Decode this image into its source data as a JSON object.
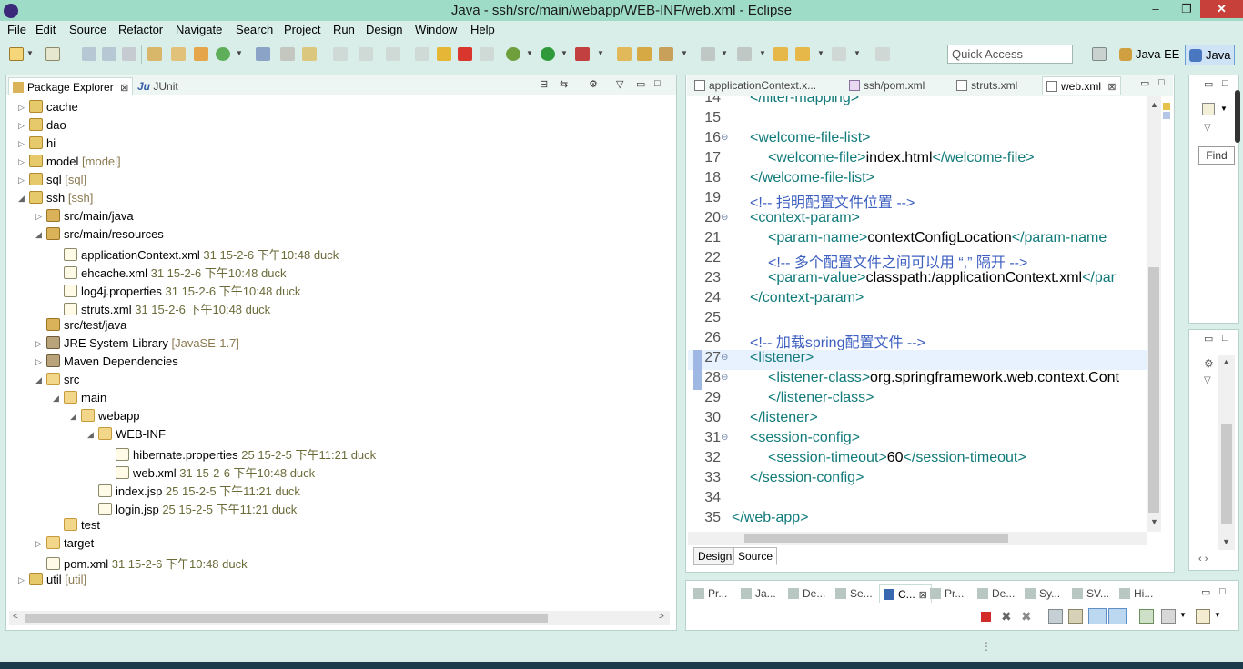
{
  "window": {
    "title": "Java - ssh/src/main/webapp/WEB-INF/web.xml - Eclipse",
    "min": "–",
    "max": "❐",
    "close": "✕"
  },
  "menu": [
    "File",
    "Edit",
    "Source",
    "Refactor",
    "Navigate",
    "Search",
    "Project",
    "Run",
    "Design",
    "Window",
    "Help"
  ],
  "toolbar": {
    "quick_access": "Quick Access",
    "perspectives": [
      "Java EE",
      "Java"
    ],
    "icons": [
      "new-icon",
      "new-dropdown-icon",
      "save-icon",
      "save-all-icon",
      "print-icon",
      "build-icon",
      "new-java-package-icon",
      "new-class-icon",
      "debug-icon",
      "run-icon",
      "run-coverage-icon",
      "external-tools-icon",
      "open-type-icon",
      "search-icon",
      "next-annotation-icon",
      "back-icon",
      "forward-icon",
      "pin-icon"
    ]
  },
  "package_explorer": {
    "tabs": [
      {
        "label": "Package Explorer",
        "close": "⊠"
      },
      {
        "label": "JUnit",
        "prefix": "Ju"
      }
    ],
    "tree": [
      {
        "label": "cache",
        "dec": "",
        "level": 0,
        "tw": "▷",
        "icon": "proj"
      },
      {
        "label": "dao",
        "dec": "",
        "level": 0,
        "tw": "▷",
        "icon": "proj"
      },
      {
        "label": "hi",
        "dec": "",
        "level": 0,
        "tw": "▷",
        "icon": "proj"
      },
      {
        "label": "model",
        "dec": "[model]",
        "level": 0,
        "tw": "▷",
        "icon": "proj"
      },
      {
        "label": "sql",
        "dec": "[sql]",
        "level": 0,
        "tw": "▷",
        "icon": "proj"
      },
      {
        "label": "ssh",
        "dec": "[ssh]",
        "level": 0,
        "tw": "◢",
        "icon": "proj"
      },
      {
        "label": "src/main/java",
        "dec": "",
        "level": 1,
        "tw": "▷",
        "icon": "pkg"
      },
      {
        "label": "src/main/resources",
        "dec": "",
        "level": 1,
        "tw": "◢",
        "icon": "pkg"
      },
      {
        "label": "applicationContext.xml",
        "dec": "31  15-2-6 下午10:48  duck",
        "level": 2,
        "tw": "",
        "icon": "file"
      },
      {
        "label": "ehcache.xml",
        "dec": "31  15-2-6 下午10:48  duck",
        "level": 2,
        "tw": "",
        "icon": "file"
      },
      {
        "label": "log4j.properties",
        "dec": "31  15-2-6 下午10:48  duck",
        "level": 2,
        "tw": "",
        "icon": "file"
      },
      {
        "label": "struts.xml",
        "dec": "31  15-2-6 下午10:48  duck",
        "level": 2,
        "tw": "",
        "icon": "file"
      },
      {
        "label": "src/test/java",
        "dec": "",
        "level": 1,
        "tw": "",
        "icon": "pkg"
      },
      {
        "label": "JRE System Library",
        "dec": "[JavaSE-1.7]",
        "level": 1,
        "tw": "▷",
        "icon": "lib"
      },
      {
        "label": "Maven Dependencies",
        "dec": "",
        "level": 1,
        "tw": "▷",
        "icon": "lib"
      },
      {
        "label": "src",
        "dec": "",
        "level": 1,
        "tw": "◢",
        "icon": "folder"
      },
      {
        "label": "main",
        "dec": "",
        "level": 2,
        "tw": "◢",
        "icon": "folder"
      },
      {
        "label": "webapp",
        "dec": "",
        "level": 3,
        "tw": "◢",
        "icon": "folder"
      },
      {
        "label": "WEB-INF",
        "dec": "",
        "level": 4,
        "tw": "◢",
        "icon": "folder"
      },
      {
        "label": "hibernate.properties",
        "dec": "25  15-2-5 下午11:21  duck",
        "level": 5,
        "tw": "",
        "icon": "file"
      },
      {
        "label": "web.xml",
        "dec": "31  15-2-6 下午10:48  duck",
        "level": 5,
        "tw": "",
        "icon": "file"
      },
      {
        "label": "index.jsp",
        "dec": "25  15-2-5 下午11:21  duck",
        "level": 4,
        "tw": "",
        "icon": "file"
      },
      {
        "label": "login.jsp",
        "dec": "25  15-2-5 下午11:21  duck",
        "level": 4,
        "tw": "",
        "icon": "file"
      },
      {
        "label": "test",
        "dec": "",
        "level": 2,
        "tw": "",
        "icon": "folder"
      },
      {
        "label": "target",
        "dec": "",
        "level": 1,
        "tw": "▷",
        "icon": "folder"
      },
      {
        "label": "pom.xml",
        "dec": "31  15-2-6 下午10:48  duck",
        "level": 1,
        "tw": "",
        "icon": "file"
      },
      {
        "label": "util",
        "dec": "[util]",
        "level": 0,
        "tw": "▷",
        "icon": "proj"
      }
    ]
  },
  "editor": {
    "tabs": [
      "applicationContext.x...",
      "ssh/pom.xml",
      "struts.xml",
      "web.xml"
    ],
    "active_tab": "web.xml",
    "close_glyph": "⊠",
    "lines": [
      {
        "n": "14",
        "fold": "",
        "indent": 1,
        "parts": [
          [
            "tag",
            "</filter-mapping>"
          ]
        ]
      },
      {
        "n": "15",
        "fold": "",
        "indent": 0,
        "parts": []
      },
      {
        "n": "16",
        "fold": "⊖",
        "indent": 1,
        "parts": [
          [
            "tag",
            "<welcome-file-list>"
          ]
        ]
      },
      {
        "n": "17",
        "fold": "",
        "indent": 2,
        "parts": [
          [
            "tag",
            "<welcome-file>"
          ],
          [
            "txt",
            "index.html"
          ],
          [
            "tag",
            "</welcome-file>"
          ]
        ]
      },
      {
        "n": "18",
        "fold": "",
        "indent": 1,
        "parts": [
          [
            "tag",
            "</welcome-file-list>"
          ]
        ]
      },
      {
        "n": "19",
        "fold": "",
        "indent": 1,
        "parts": [
          [
            "cmt",
            "<!-- 指明配置文件位置 -->"
          ]
        ]
      },
      {
        "n": "20",
        "fold": "⊖",
        "indent": 1,
        "parts": [
          [
            "tag",
            "<context-param>"
          ]
        ]
      },
      {
        "n": "21",
        "fold": "",
        "indent": 2,
        "parts": [
          [
            "tag",
            "<param-name>"
          ],
          [
            "txt",
            "contextConfigLocation"
          ],
          [
            "tag",
            "</param-name"
          ]
        ]
      },
      {
        "n": "22",
        "fold": "",
        "indent": 2,
        "parts": [
          [
            "cmt",
            "<!-- 多个配置文件之间可以用 “,” 隔开 -->"
          ]
        ]
      },
      {
        "n": "23",
        "fold": "",
        "indent": 2,
        "parts": [
          [
            "tag",
            "<param-value>"
          ],
          [
            "txt",
            "classpath:/applicationContext.xml"
          ],
          [
            "tag",
            "</par"
          ]
        ]
      },
      {
        "n": "24",
        "fold": "",
        "indent": 1,
        "parts": [
          [
            "tag",
            "</context-param>"
          ]
        ]
      },
      {
        "n": "25",
        "fold": "",
        "indent": 0,
        "parts": []
      },
      {
        "n": "26",
        "fold": "",
        "indent": 1,
        "parts": [
          [
            "cmt",
            "<!-- 加载spring配置文件 -->"
          ]
        ]
      },
      {
        "n": "27",
        "fold": "⊖",
        "indent": 1,
        "parts": [
          [
            "tag",
            "<listener>"
          ]
        ],
        "hl": true
      },
      {
        "n": "28",
        "fold": "⊖",
        "indent": 2,
        "parts": [
          [
            "tag",
            "<listener-class>"
          ],
          [
            "txt",
            "org.springframework.web.context.Cont"
          ]
        ]
      },
      {
        "n": "29",
        "fold": "",
        "indent": 2,
        "parts": [
          [
            "tag",
            "</listener-class>"
          ]
        ]
      },
      {
        "n": "30",
        "fold": "",
        "indent": 1,
        "parts": [
          [
            "tag",
            "</listener>"
          ]
        ]
      },
      {
        "n": "31",
        "fold": "⊖",
        "indent": 1,
        "parts": [
          [
            "tag",
            "<session-config>"
          ]
        ]
      },
      {
        "n": "32",
        "fold": "",
        "indent": 2,
        "parts": [
          [
            "tag",
            "<session-timeout>"
          ],
          [
            "txt",
            "60"
          ],
          [
            "tag",
            "</session-timeout>"
          ]
        ]
      },
      {
        "n": "33",
        "fold": "",
        "indent": 1,
        "parts": [
          [
            "tag",
            "</session-config>"
          ]
        ]
      },
      {
        "n": "34",
        "fold": "",
        "indent": 0,
        "parts": []
      },
      {
        "n": "35",
        "fold": "",
        "indent": 0,
        "parts": [
          [
            "tag",
            "</web-app>"
          ]
        ]
      }
    ],
    "design_tab": "Design",
    "source_tab": "Source"
  },
  "right_panel": {
    "find_label": "Find"
  },
  "bottom_panel": {
    "tabs": [
      "Pr...",
      "Ja...",
      "De...",
      "Se...",
      "C...",
      "Pr...",
      "De...",
      "Sy...",
      "SV...",
      "Hi..."
    ],
    "active_tab": "C..."
  },
  "colors": {
    "title_bar": "#9fdcc8",
    "chrome": "#d9eee8",
    "xml_tag": "#117a7a",
    "xml_comment": "#3c5fc0",
    "close_button": "#c7413a"
  }
}
